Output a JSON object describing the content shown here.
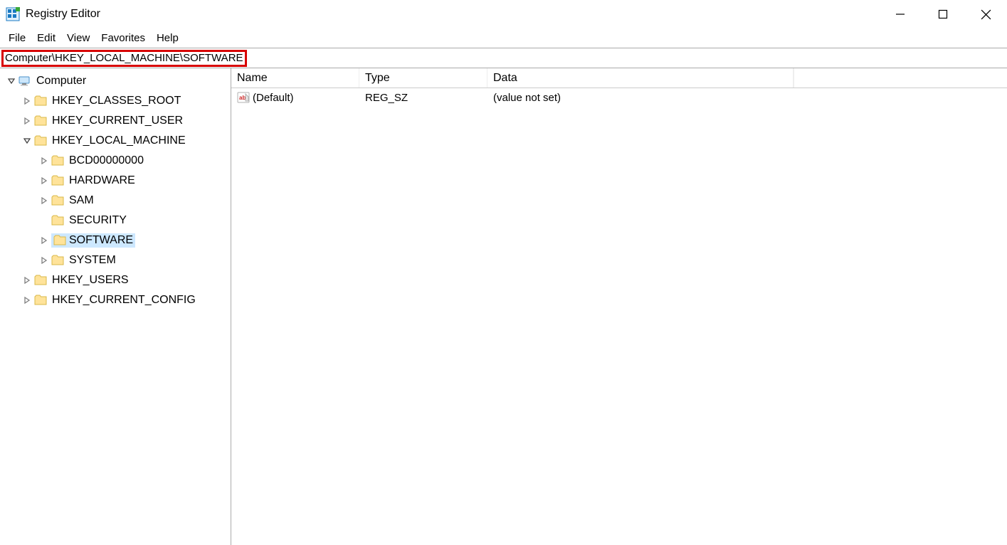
{
  "app": {
    "title": "Registry Editor"
  },
  "menu": {
    "file": "File",
    "edit": "Edit",
    "view": "View",
    "favorites": "Favorites",
    "help": "Help"
  },
  "address_bar": {
    "path": "Computer\\HKEY_LOCAL_MACHINE\\SOFTWARE"
  },
  "tree": {
    "root": "Computer",
    "hkcr": "HKEY_CLASSES_ROOT",
    "hkcu": "HKEY_CURRENT_USER",
    "hklm": "HKEY_LOCAL_MACHINE",
    "hklm_children": {
      "bcd": "BCD00000000",
      "hardware": "HARDWARE",
      "sam": "SAM",
      "security": "SECURITY",
      "software": "SOFTWARE",
      "system": "SYSTEM"
    },
    "hku": "HKEY_USERS",
    "hkcc": "HKEY_CURRENT_CONFIG"
  },
  "list": {
    "headers": {
      "name": "Name",
      "type": "Type",
      "data": "Data"
    },
    "rows": [
      {
        "name": "(Default)",
        "type": "REG_SZ",
        "data": "(value not set)"
      }
    ]
  }
}
